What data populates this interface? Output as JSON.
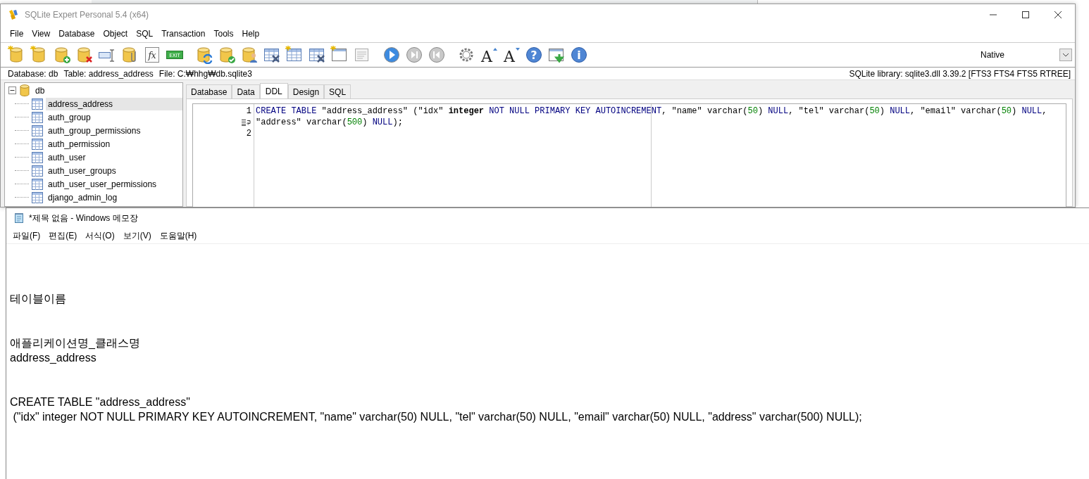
{
  "sqlite_window": {
    "title": "SQLite Expert Personal 5.4 (x64)",
    "menu": [
      "File",
      "View",
      "Database",
      "Object",
      "SQL",
      "Transaction",
      "Tools",
      "Help"
    ],
    "toolbar": [
      {
        "kind": "db-new"
      },
      {
        "kind": "db-new"
      },
      {
        "kind": "db-add"
      },
      {
        "kind": "db-delete"
      },
      {
        "kind": "rename"
      },
      {
        "kind": "attach"
      },
      {
        "kind": "fx",
        "glyph": "fx"
      },
      {
        "kind": "exit",
        "glyph": "EXIT"
      },
      {
        "kind": "db-refresh"
      },
      {
        "kind": "db-check"
      },
      {
        "kind": "db-user"
      },
      {
        "kind": "table-tools"
      },
      {
        "kind": "table-new"
      },
      {
        "kind": "table-edit"
      },
      {
        "kind": "view-new"
      },
      {
        "kind": "sql-doc"
      },
      {
        "kind": "play"
      },
      {
        "kind": "next"
      },
      {
        "kind": "prev"
      },
      {
        "kind": "gear"
      },
      {
        "kind": "font-up",
        "glyph": "A"
      },
      {
        "kind": "font-down",
        "glyph": "A"
      },
      {
        "kind": "help",
        "glyph": "?"
      },
      {
        "kind": "download"
      },
      {
        "kind": "info",
        "glyph": "i"
      }
    ],
    "mode_select": {
      "value": "Native"
    },
    "status": {
      "left": [
        "Database: db",
        "Table: address_address",
        "File: C:₩hhg₩db.sqlite3"
      ],
      "right": "SQLite library: sqlite3.dll 3.39.2 [FTS3 FTS4 FTS5 RTREE]"
    },
    "tree": [
      {
        "label": "db",
        "kind": "database",
        "expanded": true,
        "selected": false,
        "children": [
          {
            "label": "address_address",
            "kind": "table",
            "selected": true
          },
          {
            "label": "auth_group",
            "kind": "table",
            "selected": false
          },
          {
            "label": "auth_group_permissions",
            "kind": "table",
            "selected": false
          },
          {
            "label": "auth_permission",
            "kind": "table",
            "selected": false
          },
          {
            "label": "auth_user",
            "kind": "table",
            "selected": false
          },
          {
            "label": "auth_user_groups",
            "kind": "table",
            "selected": false
          },
          {
            "label": "auth_user_user_permissions",
            "kind": "table",
            "selected": false
          },
          {
            "label": "django_admin_log",
            "kind": "table",
            "selected": false
          }
        ]
      }
    ],
    "tabs": [
      {
        "label": "Database",
        "selected": false
      },
      {
        "label": "Data",
        "selected": false
      },
      {
        "label": "DDL",
        "selected": true
      },
      {
        "label": "Design",
        "selected": false
      },
      {
        "label": "SQL",
        "selected": false
      }
    ],
    "ddl": {
      "lines": [
        {
          "kind": "numbered",
          "gutter": "1",
          "tokens": [
            {
              "kind": "keyword",
              "text": "CREATE TABLE"
            },
            {
              "kind": "plain",
              "text": " \"address_address\" (\"idx\" "
            },
            {
              "kind": "type",
              "text": "integer"
            },
            {
              "kind": "keyword",
              "text": " NOT NULL PRIMARY KEY AUTOINCREMENT"
            },
            {
              "kind": "plain",
              "text": ", \"name\" varchar("
            },
            {
              "kind": "number",
              "text": "50"
            },
            {
              "kind": "plain",
              "text": ") "
            },
            {
              "kind": "keyword",
              "text": "NULL"
            },
            {
              "kind": "plain",
              "text": ", \"tel\" varchar("
            },
            {
              "kind": "number",
              "text": "50"
            },
            {
              "kind": "plain",
              "text": ") "
            },
            {
              "kind": "keyword",
              "text": "NULL"
            },
            {
              "kind": "plain",
              "text": ", \"email\" varchar("
            },
            {
              "kind": "number",
              "text": "50"
            },
            {
              "kind": "plain",
              "text": ") "
            },
            {
              "kind": "keyword",
              "text": "NULL"
            },
            {
              "kind": "plain",
              "text": ","
            }
          ]
        },
        {
          "kind": "wrapped",
          "tokens": [
            {
              "kind": "plain",
              "text": "\"address\" varchar("
            },
            {
              "kind": "number",
              "text": "500"
            },
            {
              "kind": "plain",
              "text": ") "
            },
            {
              "kind": "keyword",
              "text": "NULL"
            },
            {
              "kind": "plain",
              "text": ");"
            }
          ]
        },
        {
          "kind": "numbered",
          "gutter": "2"
        }
      ]
    }
  },
  "notepad": {
    "title": "*제목 없음 - Windows 메모장",
    "menu": [
      "파일(F)",
      "편집(E)",
      "서식(O)",
      "보기(V)",
      "도움말(H)"
    ],
    "content": "\n\n\n테이블이름\n\n\n애플리케이션명_클래스명\naddress_address\n\n\nCREATE TABLE \"address_address\"\n (\"idx\" integer NOT NULL PRIMARY KEY AUTOINCREMENT, \"name\" varchar(50) NULL, \"tel\" varchar(50) NULL, \"email\" varchar(50) NULL, \"address\" varchar(500) NULL);"
  }
}
